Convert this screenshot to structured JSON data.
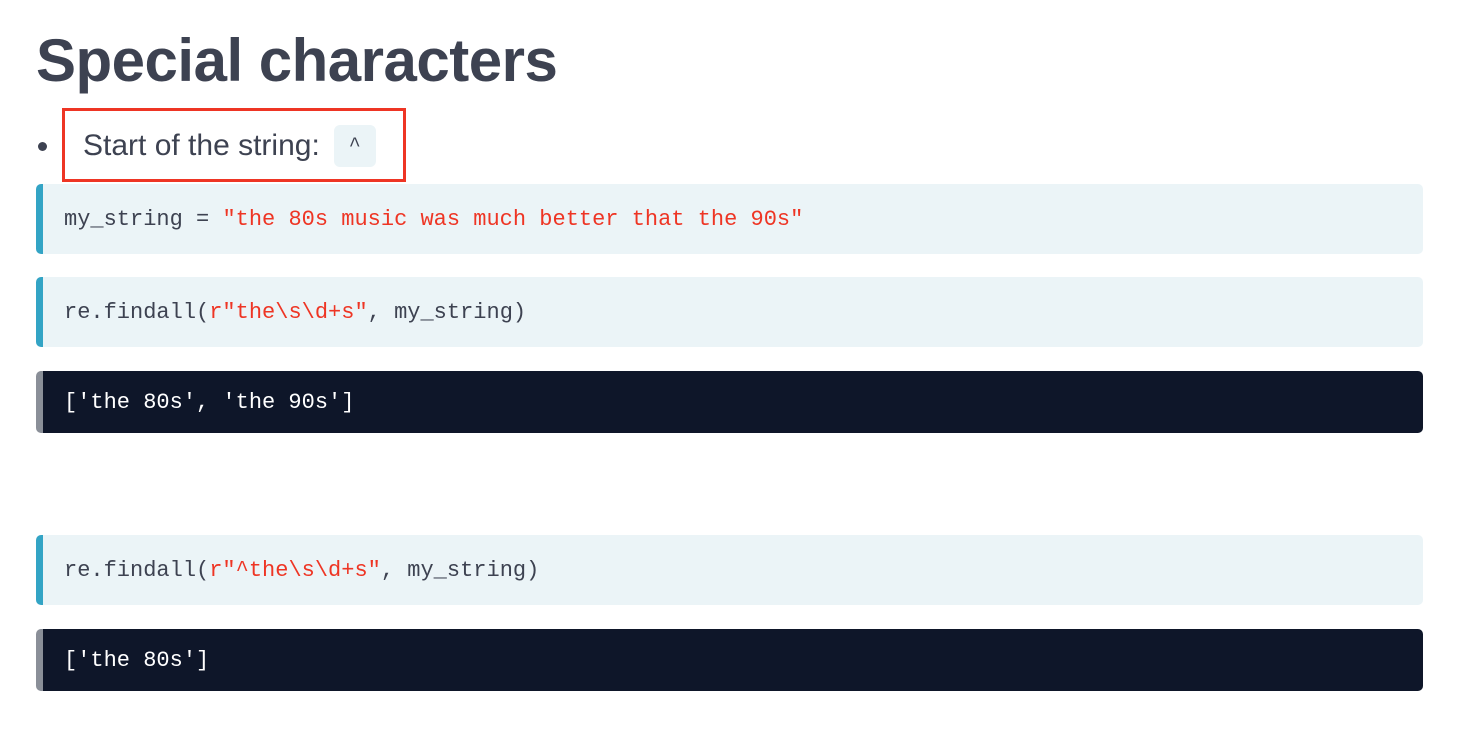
{
  "heading": "Special characters",
  "bullets": [
    {
      "text": "Start of the string:",
      "code": "^"
    }
  ],
  "code_cells": [
    {
      "kind": "input",
      "prefix": "my_string = ",
      "string": "\"the 80s music was much better that the 90s\"",
      "suffix": ""
    },
    {
      "kind": "input",
      "prefix": "re.findall(",
      "string": "r\"the\\s\\d+s\"",
      "suffix": ", my_string)"
    },
    {
      "kind": "output",
      "text": "['the 80s', 'the 90s']"
    },
    {
      "kind": "input",
      "prefix": "re.findall(",
      "string": "r\"^the\\s\\d+s\"",
      "suffix": ", my_string)"
    },
    {
      "kind": "output",
      "text": "['the 80s']"
    }
  ],
  "colors": {
    "text": "#3d4251",
    "code_bg": "#ebf4f7",
    "input_accent": "#33a4c5",
    "output_bg": "#0e1629",
    "string": "#ee3524",
    "highlight": "#ee3524"
  }
}
